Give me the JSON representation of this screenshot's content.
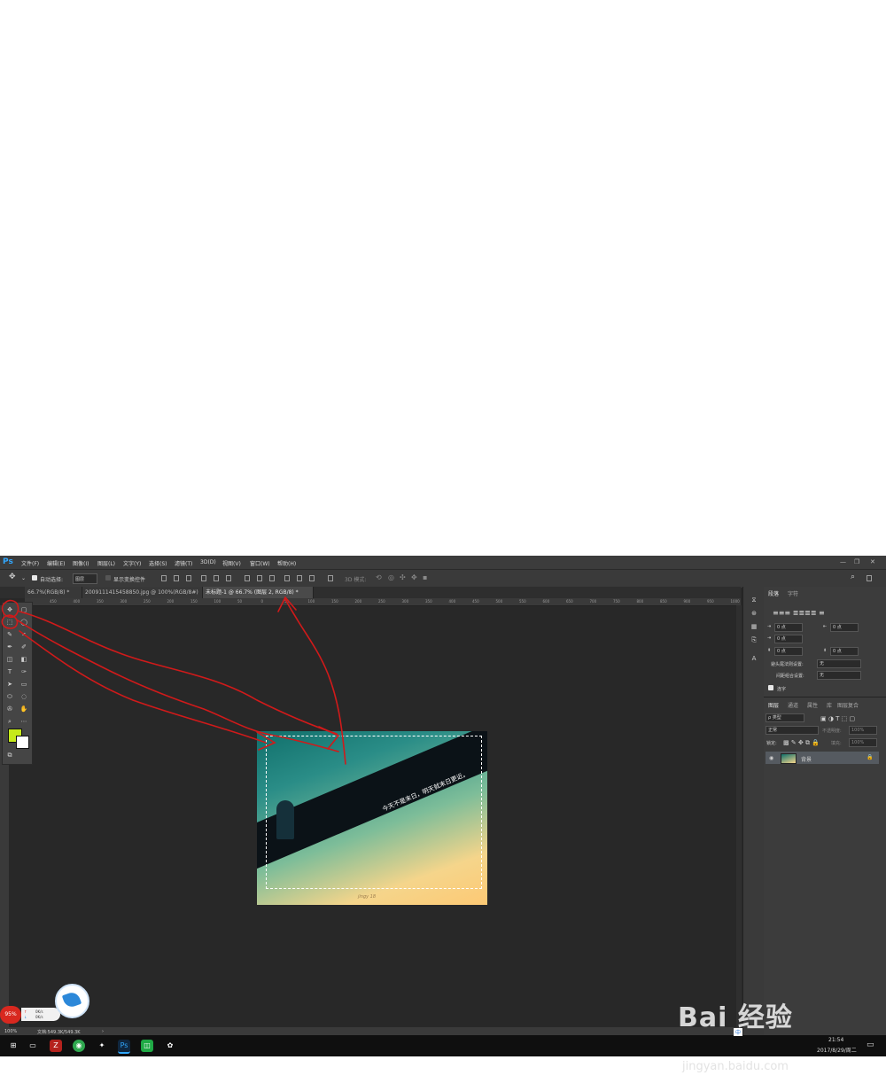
{
  "app": {
    "logo": "Ps",
    "menu": [
      "文件(F)",
      "编辑(E)",
      "图像(I)",
      "图层(L)",
      "文字(Y)",
      "选择(S)",
      "滤镜(T)",
      "3D(D)",
      "视图(V)",
      "窗口(W)",
      "帮助(H)"
    ]
  },
  "options": {
    "auto_select_label": "自动选择:",
    "auto_select_value": "图层",
    "show_transform_label": "显示变换控件",
    "mode_3d": "3D 模式:"
  },
  "tabs": [
    {
      "label": "66.7%(RGB/8) *"
    },
    {
      "label": "2009111415458850.jpg @ 100%(RGB/8#) *"
    },
    {
      "label": "未标题-1 @ 66.7% (图层 2, RGB/8) *"
    }
  ],
  "ruler_ticks": [
    "450",
    "400",
    "350",
    "300",
    "250",
    "200",
    "150",
    "100",
    "50",
    "0",
    "50",
    "100",
    "150",
    "200",
    "250",
    "300",
    "350",
    "400",
    "450",
    "500",
    "550",
    "600",
    "650",
    "700",
    "750",
    "800",
    "850",
    "900",
    "950",
    "1000"
  ],
  "canvas": {
    "caption": "今天不是末日，明天就末日更近。",
    "signature": "jingy  18"
  },
  "panel": {
    "tabs": [
      "段落",
      "字符"
    ],
    "field_value": "0 点",
    "hyphen_label": "避头尾法则设置:",
    "hyphen_value": "无",
    "spacing_label": "间距组合设置:",
    "spacing_value": "无",
    "hyphenate_label": "连字",
    "layers_tabs": [
      "图层",
      "通道",
      "属性",
      "库",
      "图层复合"
    ],
    "kind_label": "ρ 类型",
    "blend_mode": "正常",
    "opacity_label": "不透明度:",
    "opacity_value": "100%",
    "lock_label": "锁定:",
    "fill_label": "填充:",
    "fill_value": "100%",
    "layer_name": "背景"
  },
  "status": {
    "zoom": "100%",
    "doc": "文档:549.3K/549.3K"
  },
  "overlay": {
    "speed_percent": "95%",
    "up_speed": "0K/s",
    "down_speed": "0K/s"
  },
  "taskbar": {
    "time": "21:54",
    "date": "2017/8/29/周二",
    "ime": "中"
  },
  "watermark": {
    "logo": "Bai 经验",
    "url": "jingyan.baidu.com"
  },
  "colors": {
    "accent": "#31a8ff",
    "foreground": "#c6ea1a",
    "annotation": "#d11a1a"
  }
}
